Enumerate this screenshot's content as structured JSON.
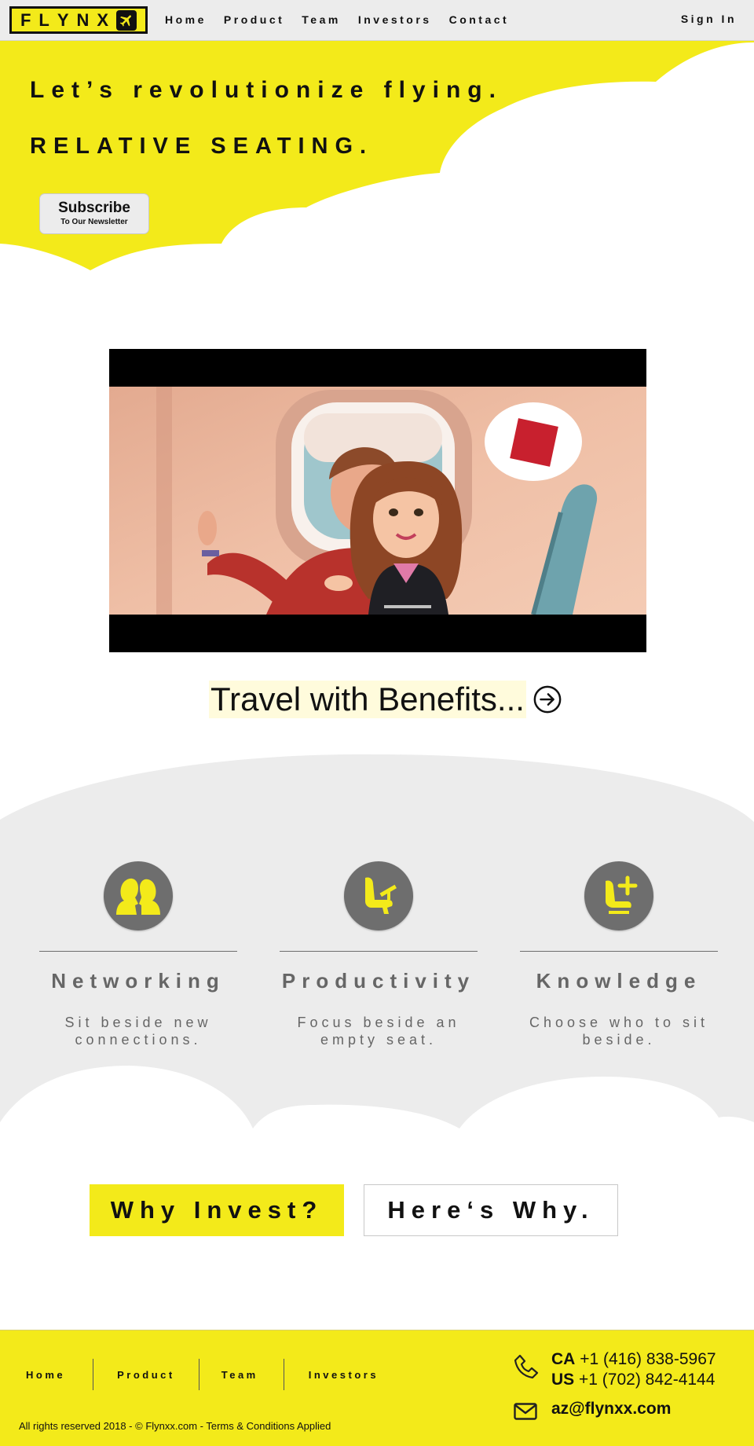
{
  "brand": {
    "logo_letters": [
      "F",
      "L",
      "Y",
      "N",
      "X"
    ],
    "accent": "#f3ea1a",
    "gray": "#ececec"
  },
  "nav": {
    "links": [
      "Home",
      "Product",
      "Team",
      "Investors",
      "Contact"
    ],
    "signin": "Sign In"
  },
  "hero": {
    "line1": "Let’s revolutionize flying.",
    "line2": "RELATIVE SEATING.",
    "subscribe_main": "Subscribe",
    "subscribe_sub": "To Our Newsletter"
  },
  "video": {
    "icon": "airplane-cabin-illustration"
  },
  "benefits": {
    "label": "Travel with Benefits...",
    "icon": "arrow-right-circle-icon"
  },
  "features": [
    {
      "icon": "people-face-to-face-icon",
      "title": "Networking",
      "text": "Sit beside new connections."
    },
    {
      "icon": "seat-with-laptop-icon",
      "title": "Productivity",
      "text": "Focus beside an empty seat."
    },
    {
      "icon": "seat-plus-icon",
      "title": "Knowledge",
      "text": "Choose who to sit beside."
    }
  ],
  "invest": {
    "why": "Why Invest?",
    "heres": "Here‘s Why."
  },
  "footer": {
    "links": [
      "Home",
      "Product",
      "Team",
      "Investors"
    ],
    "copyright": "All rights reserved 2018 - © Flynxx.com - Terms & Conditions Applied",
    "phone_ca_label": "CA",
    "phone_ca": "+1 (416) 838-5967",
    "phone_us_label": "US",
    "phone_us": "+1 (702) 842-4144",
    "email": "az@flynxx.com"
  }
}
